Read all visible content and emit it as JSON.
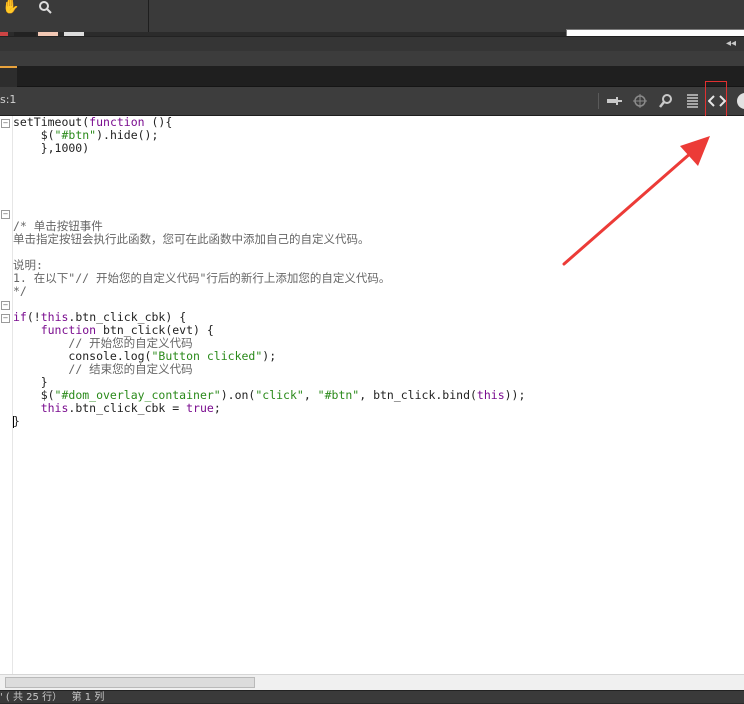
{
  "toolbar": {
    "label": "s:1"
  },
  "tab": {
    "label": ""
  },
  "status": {
    "text": "' ( 共 25 行）   第 1 列"
  },
  "icons": {
    "hand": "hand-tool-icon",
    "zoom": "zoom-icon",
    "pin": "pin-icon",
    "target": "target-icon",
    "find": "find-icon",
    "format": "format-lines-icon",
    "code_view": "code-brackets-icon",
    "help": "help-icon"
  },
  "colors": {
    "highlight": "#e03030",
    "arrow": "#ec3b37",
    "tab_accent": "#e8a23c"
  }
}
